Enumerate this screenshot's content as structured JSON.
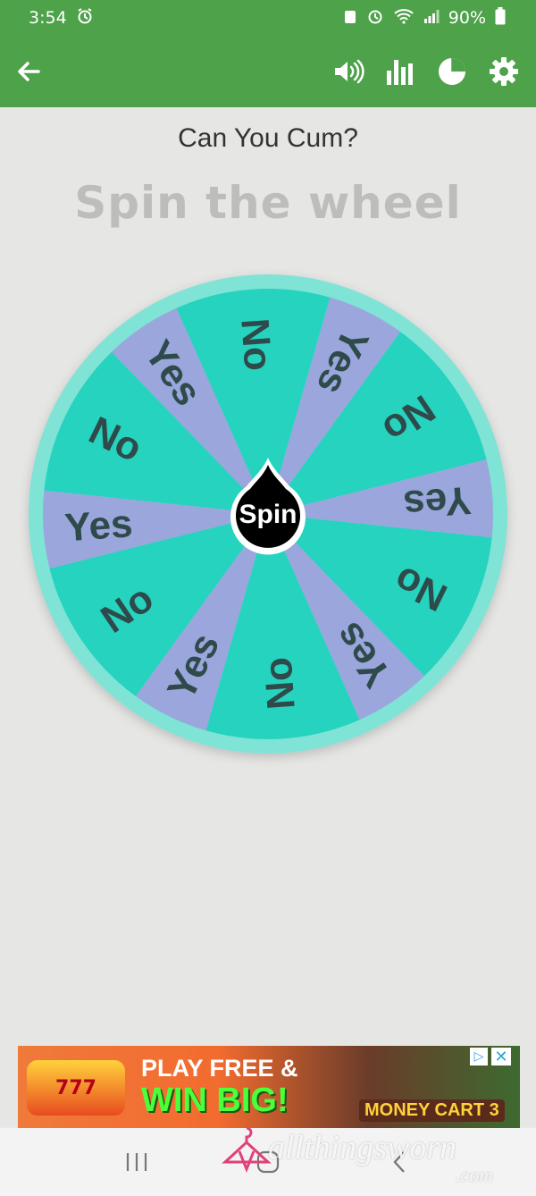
{
  "status_bar": {
    "time": "3:54",
    "battery": "90%",
    "icons": [
      "alarm-icon",
      "wifi-icon",
      "signal-icon",
      "battery-icon"
    ]
  },
  "app_bar": {
    "back_icon": "arrow-left-icon",
    "actions": [
      "volume-icon",
      "bar-chart-icon",
      "pie-chart-icon",
      "gear-icon"
    ]
  },
  "wheel": {
    "title": "Can You Cum?",
    "subtitle": "Spin the wheel",
    "spin_label": "Spin",
    "colors": {
      "no_segment": "#26d3be",
      "yes_segment": "#9aa6dc",
      "rim": "#7fe3d6",
      "label": "#2e4a4a",
      "hub": "#000000"
    },
    "segments": [
      {
        "label": "No",
        "weight": 2
      },
      {
        "label": "Yes",
        "weight": 1
      },
      {
        "label": "No",
        "weight": 2
      },
      {
        "label": "Yes",
        "weight": 1
      },
      {
        "label": "No",
        "weight": 2
      },
      {
        "label": "Yes",
        "weight": 1
      },
      {
        "label": "No",
        "weight": 2
      },
      {
        "label": "Yes",
        "weight": 1
      },
      {
        "label": "No",
        "weight": 2
      },
      {
        "label": "Yes",
        "weight": 1
      },
      {
        "label": "No",
        "weight": 2
      },
      {
        "label": "Yes",
        "weight": 1
      }
    ]
  },
  "ad": {
    "logo_text": "777",
    "line1": "PLAY FREE &",
    "line2": "WIN BIG!",
    "game_name": "MONEY CART 3",
    "choices_icon": "adchoices-icon",
    "close_icon": "close-icon"
  },
  "nav_bar": {
    "recents": "|||",
    "home": "▢",
    "back": "‹"
  },
  "watermark": {
    "text": "allthingsworn",
    "tld": ".com"
  }
}
